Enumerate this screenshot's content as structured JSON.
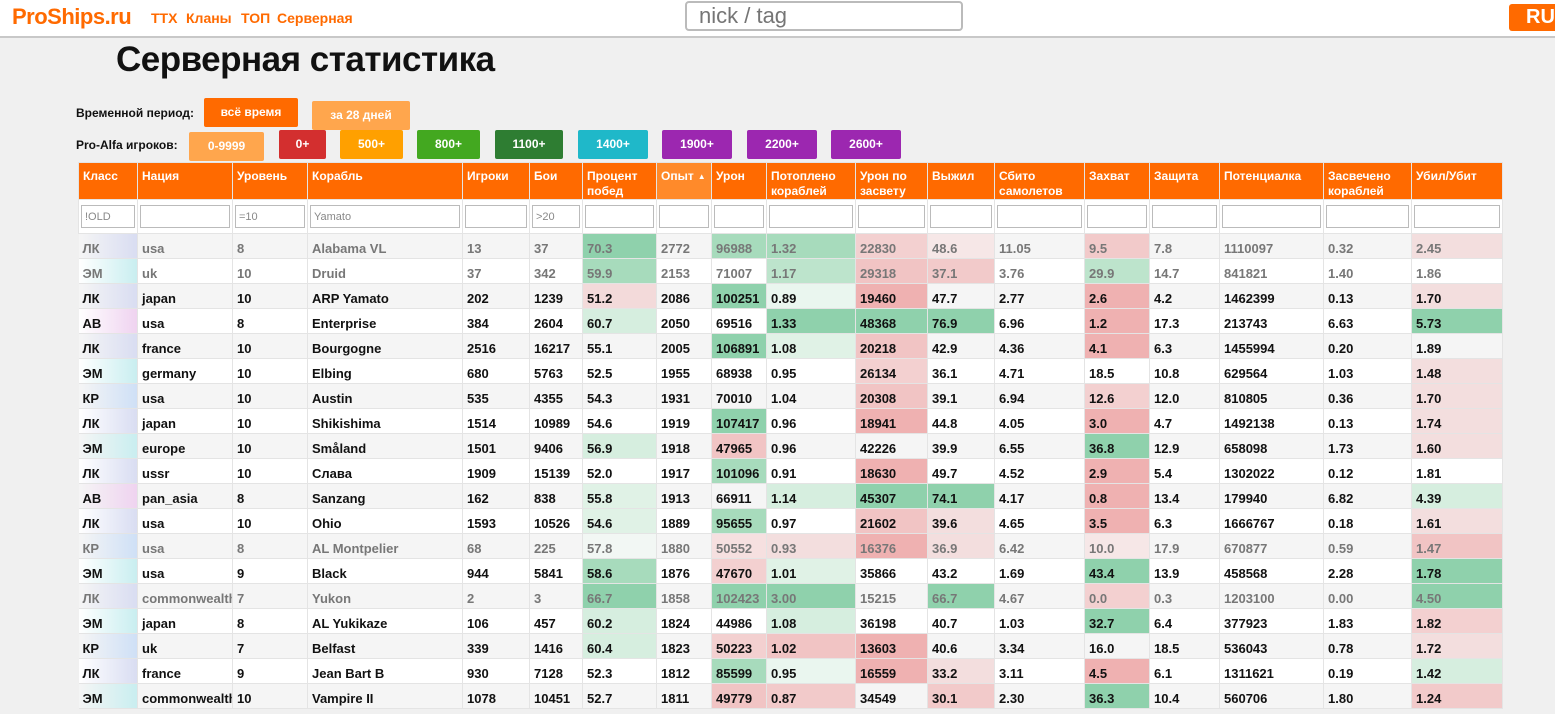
{
  "header": {
    "logo": "ProShips.ru",
    "nav": [
      "ТТХ",
      "Кланы",
      "ТОП",
      "Серверная"
    ],
    "search_placeholder": "nick / tag",
    "lang": "RU"
  },
  "page_title": "Серверная статистика",
  "filters": {
    "period_label": "Временной период:",
    "period_buttons": [
      {
        "label": "всё время",
        "color": "#ff6a00"
      },
      {
        "label": "за 28 дней",
        "color": "#ffa64d"
      }
    ],
    "rating_label": "Pro-Alfa игроков:",
    "rating_buttons": [
      {
        "label": "0-9999",
        "color": "#ffa64d"
      },
      {
        "label": "0+",
        "color": "#d32f2f"
      },
      {
        "label": "500+",
        "color": "#ffa000"
      },
      {
        "label": "800+",
        "color": "#43a820"
      },
      {
        "label": "1100+",
        "color": "#2e7d32"
      },
      {
        "label": "1400+",
        "color": "#1fb8c9"
      },
      {
        "label": "1900+",
        "color": "#9c27b0"
      },
      {
        "label": "2200+",
        "color": "#9c27b0"
      },
      {
        "label": "2600+",
        "color": "#9c27b0"
      }
    ]
  },
  "table": {
    "columns": [
      "Класс",
      "Нация",
      "Уровень",
      "Корабль",
      "Игроки",
      "Бои",
      "Процент побед",
      "Опыт",
      "Урон",
      "Потоплено кораблей",
      "Урон по засвету",
      "Выжил",
      "Сбито самолетов",
      "Захват",
      "Защита",
      "Потенциалка",
      "Засвечено кораблей",
      "Убил/Убит"
    ],
    "sorted_column": 7,
    "filter_values": [
      "!OLD",
      "",
      "=10",
      "Yamato",
      "",
      ">20",
      "",
      "",
      "",
      "",
      "",
      "",
      "",
      "",
      "",
      "",
      "",
      ""
    ],
    "rows": [
      {
        "dim": true,
        "cells": [
          "ЛК",
          "usa",
          "8",
          "Alabama VL",
          "13",
          "37",
          "70.3",
          "2772",
          "96988",
          "1.32",
          "22830",
          "48.6",
          "11.05",
          "9.5",
          "7.8",
          "1110097",
          "0.32",
          "2.45"
        ]
      },
      {
        "dim": true,
        "cells": [
          "ЭМ",
          "uk",
          "10",
          "Druid",
          "37",
          "342",
          "59.9",
          "2153",
          "71007",
          "1.17",
          "29318",
          "37.1",
          "3.76",
          "29.9",
          "14.7",
          "841821",
          "1.40",
          "1.86"
        ]
      },
      {
        "dim": false,
        "cells": [
          "ЛК",
          "japan",
          "10",
          "ARP Yamato",
          "202",
          "1239",
          "51.2",
          "2086",
          "100251",
          "0.89",
          "19460",
          "47.7",
          "2.77",
          "2.6",
          "4.2",
          "1462399",
          "0.13",
          "1.70"
        ]
      },
      {
        "dim": false,
        "cells": [
          "АВ",
          "usa",
          "8",
          "Enterprise",
          "384",
          "2604",
          "60.7",
          "2050",
          "69516",
          "1.33",
          "48368",
          "76.9",
          "6.96",
          "1.2",
          "17.3",
          "213743",
          "6.63",
          "5.73"
        ]
      },
      {
        "dim": false,
        "cells": [
          "ЛК",
          "france",
          "10",
          "Bourgogne",
          "2516",
          "16217",
          "55.1",
          "2005",
          "106891",
          "1.08",
          "20218",
          "42.9",
          "4.36",
          "4.1",
          "6.3",
          "1455994",
          "0.20",
          "1.89"
        ]
      },
      {
        "dim": false,
        "cells": [
          "ЭМ",
          "germany",
          "10",
          "Elbing",
          "680",
          "5763",
          "52.5",
          "1955",
          "68938",
          "0.95",
          "26134",
          "36.1",
          "4.71",
          "18.5",
          "10.8",
          "629564",
          "1.03",
          "1.48"
        ]
      },
      {
        "dim": false,
        "cells": [
          "КР",
          "usa",
          "10",
          "Austin",
          "535",
          "4355",
          "54.3",
          "1931",
          "70010",
          "1.04",
          "20308",
          "39.1",
          "6.94",
          "12.6",
          "12.0",
          "810805",
          "0.36",
          "1.70"
        ]
      },
      {
        "dim": false,
        "cells": [
          "ЛК",
          "japan",
          "10",
          "Shikishima",
          "1514",
          "10989",
          "54.6",
          "1919",
          "107417",
          "0.96",
          "18941",
          "44.8",
          "4.05",
          "3.0",
          "4.7",
          "1492138",
          "0.13",
          "1.74"
        ]
      },
      {
        "dim": false,
        "cells": [
          "ЭМ",
          "europe",
          "10",
          "Småland",
          "1501",
          "9406",
          "56.9",
          "1918",
          "47965",
          "0.96",
          "42226",
          "39.9",
          "6.55",
          "36.8",
          "12.9",
          "658098",
          "1.73",
          "1.60"
        ]
      },
      {
        "dim": false,
        "cells": [
          "ЛК",
          "ussr",
          "10",
          "Слава",
          "1909",
          "15139",
          "52.0",
          "1917",
          "101096",
          "0.91",
          "18630",
          "49.7",
          "4.52",
          "2.9",
          "5.4",
          "1302022",
          "0.12",
          "1.81"
        ]
      },
      {
        "dim": false,
        "cells": [
          "АВ",
          "pan_asia",
          "8",
          "Sanzang",
          "162",
          "838",
          "55.8",
          "1913",
          "66911",
          "1.14",
          "45307",
          "74.1",
          "4.17",
          "0.8",
          "13.4",
          "179940",
          "6.82",
          "4.39"
        ]
      },
      {
        "dim": false,
        "cells": [
          "ЛК",
          "usa",
          "10",
          "Ohio",
          "1593",
          "10526",
          "54.6",
          "1889",
          "95655",
          "0.97",
          "21602",
          "39.6",
          "4.65",
          "3.5",
          "6.3",
          "1666767",
          "0.18",
          "1.61"
        ]
      },
      {
        "dim": true,
        "cells": [
          "КР",
          "usa",
          "8",
          "AL Montpelier",
          "68",
          "225",
          "57.8",
          "1880",
          "50552",
          "0.93",
          "16376",
          "36.9",
          "6.42",
          "10.0",
          "17.9",
          "670877",
          "0.59",
          "1.47"
        ]
      },
      {
        "dim": false,
        "cells": [
          "ЭМ",
          "usa",
          "9",
          "Black",
          "944",
          "5841",
          "58.6",
          "1876",
          "47670",
          "1.01",
          "35866",
          "43.2",
          "1.69",
          "43.4",
          "13.9",
          "458568",
          "2.28",
          "1.78"
        ]
      },
      {
        "dim": true,
        "cells": [
          "ЛК",
          "commonwealth",
          "7",
          "Yukon",
          "2",
          "3",
          "66.7",
          "1858",
          "102423",
          "3.00",
          "15215",
          "66.7",
          "4.67",
          "0.0",
          "0.3",
          "1203100",
          "0.00",
          "4.50"
        ]
      },
      {
        "dim": false,
        "cells": [
          "ЭМ",
          "japan",
          "8",
          "AL Yukikaze",
          "106",
          "457",
          "60.2",
          "1824",
          "44986",
          "1.08",
          "36198",
          "40.7",
          "1.03",
          "32.7",
          "6.4",
          "377923",
          "1.83",
          "1.82"
        ]
      },
      {
        "dim": false,
        "cells": [
          "КР",
          "uk",
          "7",
          "Belfast",
          "339",
          "1416",
          "60.4",
          "1823",
          "50223",
          "1.02",
          "13603",
          "40.6",
          "3.34",
          "16.0",
          "18.5",
          "536043",
          "0.78",
          "1.72"
        ]
      },
      {
        "dim": false,
        "cells": [
          "ЛК",
          "france",
          "9",
          "Jean Bart B",
          "930",
          "7128",
          "52.3",
          "1812",
          "85599",
          "0.95",
          "16559",
          "33.2",
          "3.11",
          "4.5",
          "6.1",
          "1311621",
          "0.19",
          "1.42"
        ]
      },
      {
        "dim": false,
        "cells": [
          "ЭМ",
          "commonwealth",
          "10",
          "Vampire II",
          "1078",
          "10451",
          "52.7",
          "1811",
          "49779",
          "0.87",
          "34549",
          "30.1",
          "2.30",
          "36.3",
          "10.4",
          "560706",
          "1.80",
          "1.24"
        ]
      }
    ],
    "cell_colors": {
      "0": {
        "6": "#8fd1ac",
        "8": "#a7dbbc",
        "9": "#a7dbbc",
        "10": "#f3d0d0",
        "11": "#f6e7e7",
        "13": "#f2caca",
        "17": "#f3dede"
      },
      "1": {
        "6": "#a7dbbc",
        "9": "#bde4cc",
        "10": "#f1c4c4",
        "11": "#f2caca",
        "13": "#bde4cc"
      },
      "2": {
        "6": "#f3dada",
        "8": "#8fd1ac",
        "9": "#eaf6ef",
        "10": "#efb1b1",
        "13": "#efb1b1",
        "17": "#f3dede"
      },
      "3": {
        "6": "#d6eedf",
        "9": "#8fd1ac",
        "10": "#8fd1ac",
        "11": "#8fd1ac",
        "13": "#efb1b1",
        "17": "#8fd1ac"
      },
      "4": {
        "8": "#8fd1ac",
        "9": "#e0f2e6",
        "10": "#f1c4c4",
        "13": "#efb1b1"
      },
      "5": {
        "10": "#f3d0d0",
        "17": "#f3dede"
      },
      "6": {
        "10": "#f1c4c4",
        "13": "#f3d0d0",
        "17": "#f3dede"
      },
      "7": {
        "8": "#8fd1ac",
        "10": "#efb1b1",
        "13": "#efb1b1",
        "17": "#f3dede"
      },
      "8": {
        "6": "#d6eedf",
        "8": "#f1c4c4",
        "13": "#8fd1ac",
        "17": "#f3dede"
      },
      "9": {
        "8": "#a7dbbc",
        "10": "#efb1b1",
        "13": "#efb1b1"
      },
      "10": {
        "6": "#e0f2e6",
        "9": "#d6eedf",
        "10": "#8fd1ac",
        "11": "#8fd1ac",
        "13": "#efb1b1",
        "17": "#d6eedf"
      },
      "11": {
        "6": "#e0f2e6",
        "8": "#a7dbbc",
        "10": "#f1c4c4",
        "11": "#f3dede",
        "13": "#efb1b1",
        "17": "#f3dede"
      },
      "12": {
        "6": "#f2f7f4",
        "8": "#f6e0e0",
        "9": "#f3dede",
        "10": "#efb1b1",
        "11": "#f3dede",
        "13": "#f6e7e7",
        "17": "#f1c4c4"
      },
      "13": {
        "6": "#a7dbbc",
        "8": "#f3d0d0",
        "9": "#e0f2e6",
        "13": "#8fd1ac",
        "17": "#8fd1ac"
      },
      "14": {
        "6": "#8fd1ac",
        "8": "#8fd1ac",
        "9": "#8fd1ac",
        "11": "#8fd1ac",
        "13": "#f3d0d0",
        "17": "#8fd1ac"
      },
      "15": {
        "6": "#d6eedf",
        "9": "#d6eedf",
        "13": "#8fd1ac",
        "17": "#f3d0d0"
      },
      "16": {
        "6": "#d6eedf",
        "8": "#f3d0d0",
        "9": "#f1c4c4",
        "10": "#efb1b1",
        "17": "#f3dede"
      },
      "17": {
        "8": "#a7dbbc",
        "9": "#eaf6ef",
        "10": "#efb1b1",
        "11": "#f3dede",
        "13": "#efb1b1",
        "17": "#d6eedf"
      },
      "18": {
        "8": "#f1c4c4",
        "9": "#f2caca",
        "11": "#f2caca",
        "13": "#8fd1ac",
        "17": "#f2caca"
      }
    },
    "class_colors": {
      "ЛК": "#d9ddf2",
      "ЭМ": "#c9eef0",
      "АВ": "#efd3f0",
      "КР": "#cfe0f6"
    }
  }
}
